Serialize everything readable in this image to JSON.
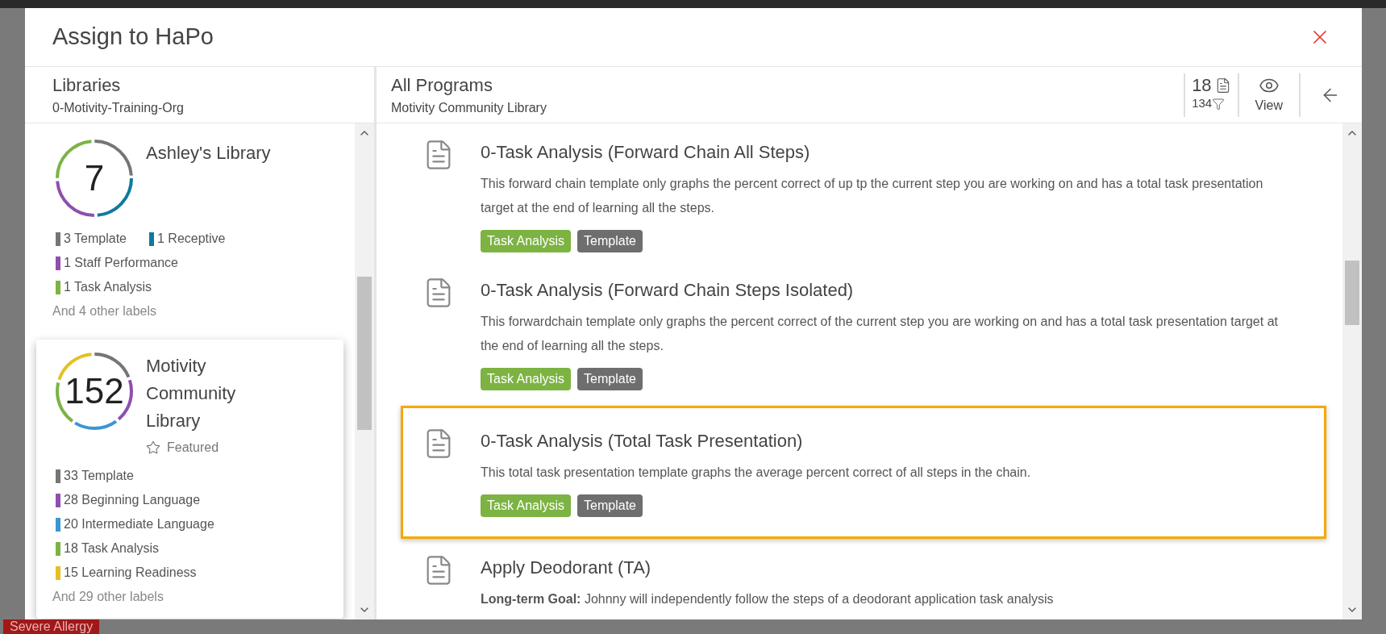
{
  "backdrop": {
    "badge": "Severe Allergy"
  },
  "dialog": {
    "title": "Assign to HaPo"
  },
  "libraries_panel": {
    "title": "Libraries",
    "subtitle": "0-Motivity-Training-Org"
  },
  "libraries": [
    {
      "count": "7",
      "name": "Ashley's Library",
      "featured": false,
      "selected": false,
      "labels": [
        {
          "text": "3 Template",
          "color": "#757575"
        },
        {
          "text": "1 Receptive",
          "color": "#0f7a9c"
        },
        {
          "text": "1 Staff Performance",
          "color": "#8e4fb0"
        },
        {
          "text": "1 Task Analysis",
          "color": "#7cb342"
        }
      ],
      "more": "And 4 other labels"
    },
    {
      "count": "152",
      "name": "Motivity Community Library",
      "featured": true,
      "featured_label": "Featured",
      "selected": true,
      "labels": [
        {
          "text": "33 Template",
          "color": "#757575"
        },
        {
          "text": "28 Beginning Language",
          "color": "#8e4fb0"
        },
        {
          "text": "20 Intermediate Language",
          "color": "#3a96d2"
        },
        {
          "text": "18 Task Analysis",
          "color": "#7cb342"
        },
        {
          "text": "15 Learning Readiness",
          "color": "#e5bf26"
        }
      ],
      "more": "And 29 other labels"
    }
  ],
  "programs_panel": {
    "title": "All Programs",
    "subtitle": "Motivity Community Library",
    "program_count": "18",
    "filter_count": "134",
    "view_label": "View"
  },
  "programs": [
    {
      "title": "0-Task Analysis (Forward Chain All Steps)",
      "description": "This forward chain template only graphs the percent correct of up tp the current step you are working on and has a total task presentation target at the end of learning all the steps.",
      "selected": false,
      "tags": [
        {
          "text": "Task Analysis",
          "color": "#7cb342"
        },
        {
          "text": "Template",
          "color": "#6e6e6e"
        }
      ]
    },
    {
      "title": "0-Task Analysis (Forward Chain Steps Isolated)",
      "description": "This forwardchain template only graphs the percent correct of the current step you are working on and has a total task presentation target at the end of learning all the steps.",
      "selected": false,
      "tags": [
        {
          "text": "Task Analysis",
          "color": "#7cb342"
        },
        {
          "text": "Template",
          "color": "#6e6e6e"
        }
      ]
    },
    {
      "title": "0-Task Analysis (Total Task Presentation)",
      "description": "This total task presentation template graphs the average percent correct of all steps in the chain.",
      "selected": true,
      "tags": [
        {
          "text": "Task Analysis",
          "color": "#7cb342"
        },
        {
          "text": "Template",
          "color": "#6e6e6e"
        }
      ]
    },
    {
      "title": "Apply Deodorant (TA)",
      "description": "**Long-term Goal:** Johnny will independently follow the steps of a deodorant application task analysis",
      "selected": false
    }
  ]
}
